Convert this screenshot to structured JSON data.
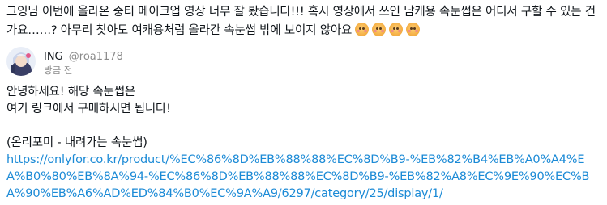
{
  "comment": {
    "text": "그잉님 이번에 올라온 중티 메이크업 영상 너무 잘 봤습니다!!! 혹시 영상에서 쓰인 남캐용 속눈썹은 어디서 구할 수 있는 건가요……? 아무리 찾아도 여캐용처럼 올라간 속눈썹 밖에 보이지 않아요",
    "emoji_icons": [
      "pleading-face-icon",
      "pleading-face-icon",
      "pleading-face-icon",
      "pleading-face-icon"
    ]
  },
  "reply": {
    "author_name": "ING",
    "author_handle": "@roa1178",
    "timestamp": "방금 전",
    "lines": [
      "안녕하세요! 해당 속눈썹은",
      "여기 링크에서 구매하시면 됩니다!"
    ],
    "product_label": "(온리포미 - 내려가는 속눈썹)",
    "link_text": "https://onlyfor.co.kr/product/%EC%86%8D%EB%88%88%EC%8D%B9-%EB%82%B4%EB%A0%A4%EA%B0%80%EB%8A%94-%EC%86%8D%EB%88%88%EC%8D%B9-%EB%82%A8%EC%9E%90%EC%BA%90%EB%A6%AD%ED%84%B0%EC%9A%A9/6297/category/25/display/1/",
    "link_color": "#1b8ad6"
  }
}
